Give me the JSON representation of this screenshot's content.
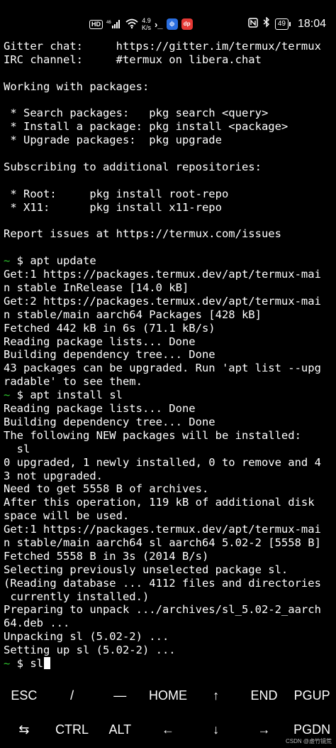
{
  "status_bar": {
    "hd": "HD",
    "network": "46",
    "speed_value": "4.9",
    "speed_unit": "K/s",
    "battery": "49",
    "time": "18:04",
    "icons": [
      "signal-icon",
      "wifi-icon",
      "terminal-icon",
      "app-icon-blue",
      "app-icon-red",
      "nfc-icon",
      "bluetooth-icon",
      "battery-icon"
    ],
    "app_blue_glyph": "ф",
    "app_red_glyph": "dp"
  },
  "terminal": {
    "lines": [
      {
        "prompt": "",
        "text": "Gitter chat:     https://gitter.im/termux/termux"
      },
      {
        "prompt": "",
        "text": "IRC channel:     #termux on libera.chat"
      },
      {
        "prompt": "",
        "text": ""
      },
      {
        "prompt": "",
        "text": "Working with packages:"
      },
      {
        "prompt": "",
        "text": ""
      },
      {
        "prompt": "",
        "text": " * Search packages:   pkg search <query>"
      },
      {
        "prompt": "",
        "text": " * Install a package: pkg install <package>"
      },
      {
        "prompt": "",
        "text": " * Upgrade packages:  pkg upgrade"
      },
      {
        "prompt": "",
        "text": ""
      },
      {
        "prompt": "",
        "text": "Subscribing to additional repositories:"
      },
      {
        "prompt": "",
        "text": ""
      },
      {
        "prompt": "",
        "text": " * Root:     pkg install root-repo"
      },
      {
        "prompt": "",
        "text": " * X11:      pkg install x11-repo"
      },
      {
        "prompt": "",
        "text": ""
      },
      {
        "prompt": "",
        "text": "Report issues at https://termux.com/issues"
      },
      {
        "prompt": "",
        "text": ""
      },
      {
        "prompt": "~",
        "text": " $ apt update"
      },
      {
        "prompt": "",
        "text": "Get:1 https://packages.termux.dev/apt/termux-mai"
      },
      {
        "prompt": "",
        "text": "n stable InRelease [14.0 kB]"
      },
      {
        "prompt": "",
        "text": "Get:2 https://packages.termux.dev/apt/termux-mai"
      },
      {
        "prompt": "",
        "text": "n stable/main aarch64 Packages [428 kB]"
      },
      {
        "prompt": "",
        "text": "Fetched 442 kB in 6s (71.1 kB/s)"
      },
      {
        "prompt": "",
        "text": "Reading package lists... Done"
      },
      {
        "prompt": "",
        "text": "Building dependency tree... Done"
      },
      {
        "prompt": "",
        "text": "43 packages can be upgraded. Run 'apt list --upg"
      },
      {
        "prompt": "",
        "text": "radable' to see them."
      },
      {
        "prompt": "~",
        "text": " $ apt install sl"
      },
      {
        "prompt": "",
        "text": "Reading package lists... Done"
      },
      {
        "prompt": "",
        "text": "Building dependency tree... Done"
      },
      {
        "prompt": "",
        "text": "The following NEW packages will be installed:"
      },
      {
        "prompt": "",
        "text": "  sl"
      },
      {
        "prompt": "",
        "text": "0 upgraded, 1 newly installed, 0 to remove and 4"
      },
      {
        "prompt": "",
        "text": "3 not upgraded."
      },
      {
        "prompt": "",
        "text": "Need to get 5558 B of archives."
      },
      {
        "prompt": "",
        "text": "After this operation, 119 kB of additional disk"
      },
      {
        "prompt": "",
        "text": "space will be used."
      },
      {
        "prompt": "",
        "text": "Get:1 https://packages.termux.dev/apt/termux-mai"
      },
      {
        "prompt": "",
        "text": "n stable/main aarch64 sl aarch64 5.02-2 [5558 B]"
      },
      {
        "prompt": "",
        "text": "Fetched 5558 B in 3s (2014 B/s)"
      },
      {
        "prompt": "",
        "text": "Selecting previously unselected package sl."
      },
      {
        "prompt": "",
        "text": "(Reading database ... 4112 files and directories"
      },
      {
        "prompt": "",
        "text": " currently installed.)"
      },
      {
        "prompt": "",
        "text": "Preparing to unpack .../archives/sl_5.02-2_aarch"
      },
      {
        "prompt": "",
        "text": "64.deb ..."
      },
      {
        "prompt": "",
        "text": "Unpacking sl (5.02-2) ..."
      },
      {
        "prompt": "",
        "text": "Setting up sl (5.02-2) ..."
      },
      {
        "prompt": "~",
        "text": " $ sl"
      }
    ]
  },
  "extra_keys": {
    "row1": [
      "ESC",
      "/",
      "—",
      "HOME",
      "↑",
      "END",
      "PGUP"
    ],
    "row2": [
      "⇆",
      "CTRL",
      "ALT",
      "←",
      "↓",
      "→",
      "PGDN"
    ]
  },
  "watermark": "CSDN @虚竹镜荒"
}
